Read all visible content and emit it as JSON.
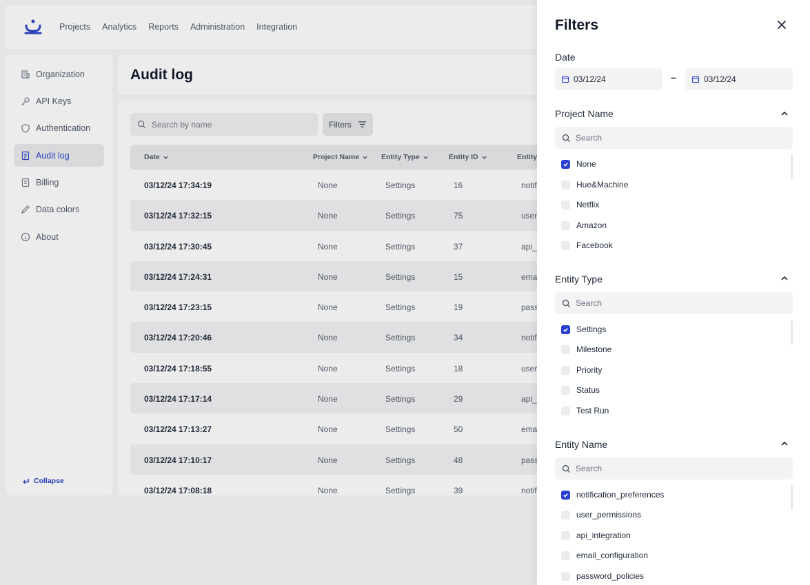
{
  "topnav": {
    "items": [
      "Projects",
      "Analytics",
      "Reports",
      "Administration",
      "Integration"
    ]
  },
  "sidebar": {
    "items": [
      {
        "label": "Organization",
        "icon": "building-icon"
      },
      {
        "label": "API Keys",
        "icon": "key-icon"
      },
      {
        "label": "Authentication",
        "icon": "shield-icon"
      },
      {
        "label": "Audit log",
        "icon": "document-icon"
      },
      {
        "label": "Billing",
        "icon": "receipt-icon"
      },
      {
        "label": "Data colors",
        "icon": "pen-icon"
      },
      {
        "label": "About",
        "icon": "info-icon"
      }
    ],
    "active": "Audit log",
    "collapse_label": "Collapse"
  },
  "page": {
    "title": "Audit log"
  },
  "toolbar": {
    "search_placeholder": "Search by name",
    "filters_label": "Filters"
  },
  "table": {
    "headers": [
      "Date",
      "Project Name",
      "Entity Type",
      "Entity ID",
      "Entity"
    ],
    "rows": [
      [
        "03/12/24 17:34:19",
        "None",
        "Settings",
        "16",
        "notif"
      ],
      [
        "03/12/24 17:32:15",
        "None",
        "Settings",
        "75",
        "user"
      ],
      [
        "03/12/24 17:30:45",
        "None",
        "Settings",
        "37",
        "api_"
      ],
      [
        "03/12/24 17:24:31",
        "None",
        "Settings",
        "15",
        "ema"
      ],
      [
        "03/12/24 17:23:15",
        "None",
        "Settings",
        "19",
        "pass"
      ],
      [
        "03/12/24 17:20:46",
        "None",
        "Settings",
        "34",
        "notif"
      ],
      [
        "03/12/24 17:18:55",
        "None",
        "Settings",
        "18",
        "user"
      ],
      [
        "03/12/24 17:17:14",
        "None",
        "Settings",
        "29",
        "api_"
      ],
      [
        "03/12/24 17:13:27",
        "None",
        "Settings",
        "50",
        "ema"
      ],
      [
        "03/12/24 17:10:17",
        "None",
        "Settings",
        "48",
        "pass"
      ],
      [
        "03/12/24 17:08:18",
        "None",
        "Settings",
        "39",
        "notif"
      ]
    ]
  },
  "filters": {
    "title": "Filters",
    "date": {
      "label": "Date",
      "from": "03/12/24",
      "to": "03/12/24",
      "separator": "–"
    },
    "project_name": {
      "label": "Project Name",
      "search_placeholder": "Search",
      "options": [
        {
          "label": "None",
          "checked": true
        },
        {
          "label": "Hue&Machine",
          "checked": false
        },
        {
          "label": "Netflix",
          "checked": false
        },
        {
          "label": "Amazon",
          "checked": false
        },
        {
          "label": "Facebook",
          "checked": false
        }
      ]
    },
    "entity_type": {
      "label": "Entity Type",
      "search_placeholder": "Search",
      "options": [
        {
          "label": "Settings",
          "checked": true
        },
        {
          "label": "Milestone",
          "checked": false
        },
        {
          "label": "Priority",
          "checked": false
        },
        {
          "label": "Status",
          "checked": false
        },
        {
          "label": "Test Run",
          "checked": false
        }
      ]
    },
    "entity_name": {
      "label": "Entity Name",
      "search_placeholder": "Search",
      "options": [
        {
          "label": "notification_preferences",
          "checked": true
        },
        {
          "label": "user_permissions",
          "checked": false
        },
        {
          "label": "api_integration",
          "checked": false
        },
        {
          "label": "email_configuration",
          "checked": false
        },
        {
          "label": "password_policies",
          "checked": false
        }
      ]
    }
  },
  "colors": {
    "accent": "#2b3fd0",
    "brand": "#2b3fb8"
  }
}
